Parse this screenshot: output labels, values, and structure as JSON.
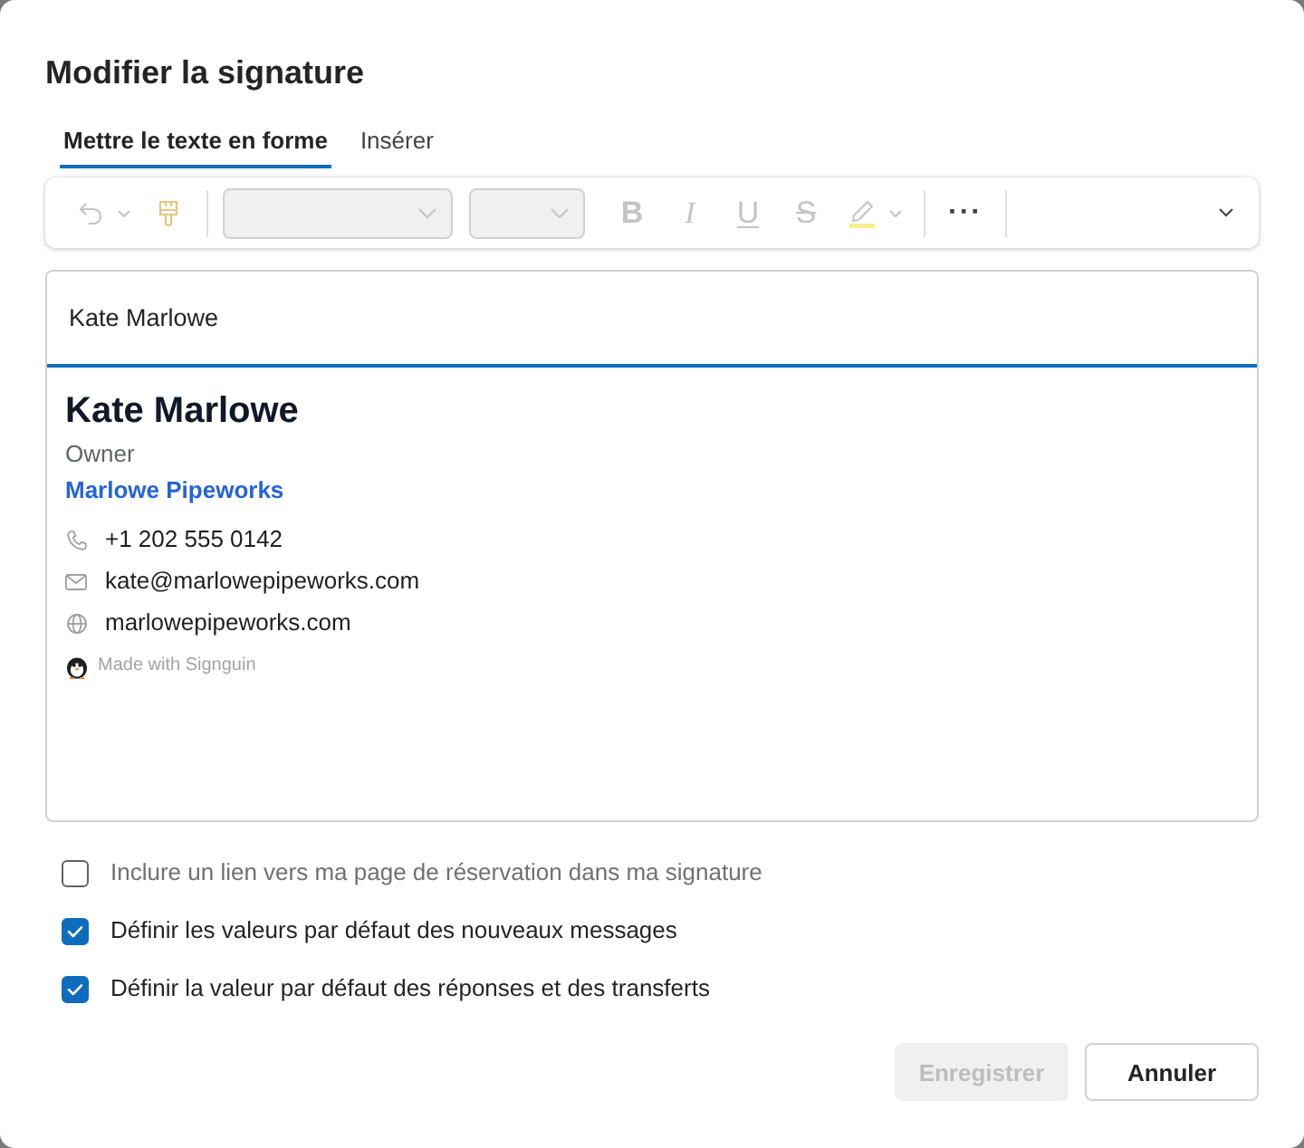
{
  "dialog": {
    "title": "Modifier la signature"
  },
  "tabs": [
    {
      "label": "Mettre le texte en forme",
      "selected": true
    },
    {
      "label": "Insérer",
      "selected": false
    }
  ],
  "toolbar": {
    "items": [
      {
        "kind": "undo",
        "disabled": true
      },
      {
        "kind": "painter",
        "disabled": true
      },
      {
        "kind": "separator"
      },
      {
        "kind": "font",
        "disabled": true
      },
      {
        "kind": "size",
        "disabled": true
      },
      {
        "kind": "bold",
        "label": "B",
        "disabled": true
      },
      {
        "kind": "italic",
        "label": "I",
        "disabled": true
      },
      {
        "kind": "underline",
        "label": "U",
        "disabled": true
      },
      {
        "kind": "strikethrough",
        "label": "S",
        "disabled": true
      },
      {
        "kind": "highlight",
        "disabled": true
      },
      {
        "kind": "separator"
      },
      {
        "kind": "more",
        "label": "···",
        "disabled": false
      },
      {
        "kind": "separator"
      },
      {
        "kind": "expand",
        "disabled": false
      }
    ]
  },
  "editor": {
    "name_field": {
      "value": "Kate Marlowe"
    },
    "signature": {
      "name": "Kate Marlowe",
      "title": "Owner",
      "company": "Marlowe Pipeworks",
      "contacts": [
        {
          "kind": "phone",
          "text": "+1 202 555 0142"
        },
        {
          "kind": "email",
          "text": "kate@marlowepipeworks.com"
        },
        {
          "kind": "web",
          "text": "marlowepipeworks.com"
        }
      ],
      "credit": "Made with Signguin"
    }
  },
  "options": [
    {
      "label": "Inclure un lien vers ma page de réservation dans ma signature",
      "checked": false,
      "disabled": true
    },
    {
      "label": "Définir les valeurs par défaut des nouveaux messages",
      "checked": true,
      "disabled": false
    },
    {
      "label": "Définir la valeur par défaut des réponses et des transferts",
      "checked": true,
      "disabled": false
    }
  ],
  "buttons": [
    {
      "label": "Enregistrer",
      "kind": "primary",
      "disabled": true
    },
    {
      "label": "Annuler",
      "kind": "secondary",
      "disabled": false
    }
  ]
}
